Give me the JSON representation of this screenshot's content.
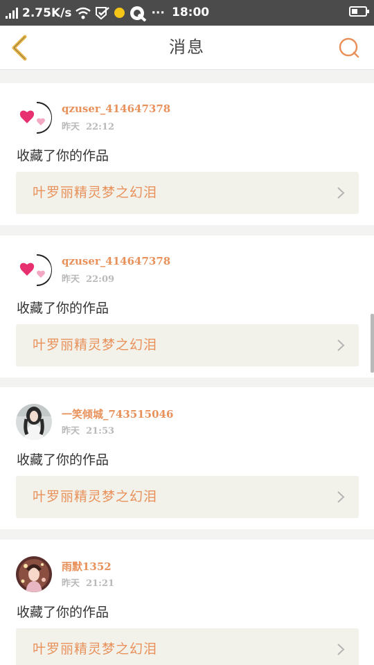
{
  "status_bar": {
    "speed": "2.75K/s",
    "time": "18:00",
    "more": "···",
    "battery_level": 0.45
  },
  "header": {
    "title": "消息"
  },
  "notifications": [
    {
      "username": "qzuser_414647378",
      "date_label": "昨天",
      "time": "22:12",
      "action": "收藏了你的作品",
      "work_title": "叶罗丽精灵梦之幻泪",
      "avatar": "hearts-avatar"
    },
    {
      "username": "qzuser_414647378",
      "date_label": "昨天",
      "time": "22:09",
      "action": "收藏了你的作品",
      "work_title": "叶罗丽精灵梦之幻泪",
      "avatar": "hearts-avatar"
    },
    {
      "username": "一笑倾城_743515046",
      "date_label": "昨天",
      "time": "21:53",
      "action": "收藏了你的作品",
      "work_title": "叶罗丽精灵梦之幻泪",
      "avatar": "girl-photo-avatar"
    },
    {
      "username": "雨默1352",
      "date_label": "昨天",
      "time": "21:21",
      "action": "收藏了你的作品",
      "work_title": "叶罗丽精灵梦之幻泪",
      "avatar": "anime-avatar"
    }
  ],
  "colors": {
    "accent": "#e8915b",
    "back_icon": "#e8b64a",
    "card_link_bg": "#f3f2ea"
  }
}
